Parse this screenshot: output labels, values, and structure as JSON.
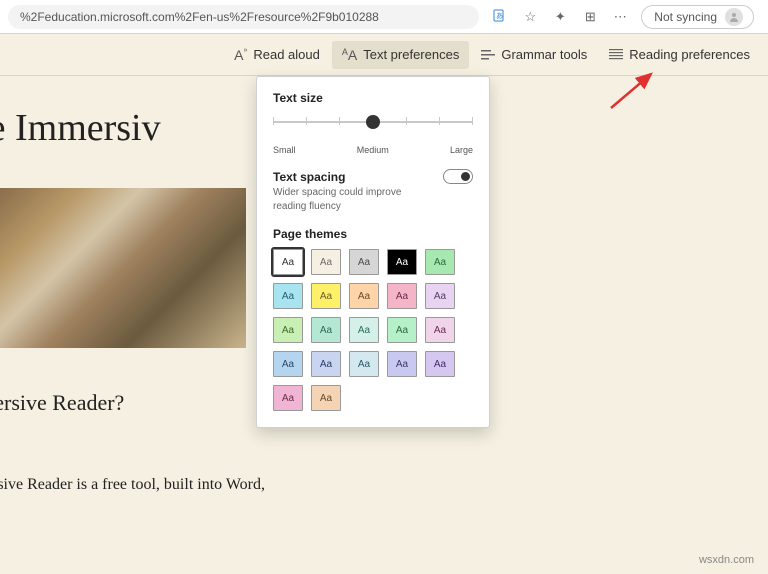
{
  "address_bar": {
    "url": "%2Feducation.microsoft.com%2Fen-us%2Fresource%2F9b010288",
    "sync_label": "Not syncing"
  },
  "toolbar": {
    "read_aloud": "Read aloud",
    "text_preferences": "Text preferences",
    "grammar_tools": "Grammar tools",
    "reading_preferences": "Reading preferences"
  },
  "page": {
    "heading1": "ut the Immersiv",
    "heading2": "mmersive Reader?",
    "body1": "mmersive Reader is a free tool, built into Word,"
  },
  "popover": {
    "text_size_label": "Text size",
    "slider": {
      "min_label": "Small",
      "mid_label": "Medium",
      "max_label": "Large"
    },
    "text_spacing_label": "Text spacing",
    "text_spacing_hint": "Wider spacing could improve reading fluency",
    "page_themes_label": "Page themes",
    "swatch_text": "Aa",
    "themes": [
      {
        "bg": "#ffffff",
        "fg": "#333333",
        "selected": true
      },
      {
        "bg": "#f5f0e1",
        "fg": "#6b6b6b"
      },
      {
        "bg": "#d6d6d6",
        "fg": "#4a4a4a"
      },
      {
        "bg": "#000000",
        "fg": "#ffffff"
      },
      {
        "bg": "#a7e8b0",
        "fg": "#2a6b36"
      },
      {
        "bg": "#a8e4f0",
        "fg": "#2a5c6b"
      },
      {
        "bg": "#fff06a",
        "fg": "#6b5a2a"
      },
      {
        "bg": "#ffd4a8",
        "fg": "#6b4a2a"
      },
      {
        "bg": "#f5b5c8",
        "fg": "#6b2a4a"
      },
      {
        "bg": "#e8d4f0",
        "fg": "#5a3a6b"
      },
      {
        "bg": "#c8f0b5",
        "fg": "#3a6b2a"
      },
      {
        "bg": "#b5e8d4",
        "fg": "#2a6b5a"
      },
      {
        "bg": "#d4f0e8",
        "fg": "#2a6b5a"
      },
      {
        "bg": "#b5f0c8",
        "fg": "#2a6b3a"
      },
      {
        "bg": "#f0d4e8",
        "fg": "#6b2a5a"
      },
      {
        "bg": "#b5d4f0",
        "fg": "#2a4a6b"
      },
      {
        "bg": "#c8d4f0",
        "fg": "#2a3a6b"
      },
      {
        "bg": "#d4e8f0",
        "fg": "#2a5a6b"
      },
      {
        "bg": "#c8c8f0",
        "fg": "#3a3a6b"
      },
      {
        "bg": "#d4c8f0",
        "fg": "#4a2a6b"
      },
      {
        "bg": "#f0b5d4",
        "fg": "#6b2a4a"
      },
      {
        "bg": "#f5d4b5",
        "fg": "#6b4a2a"
      }
    ]
  },
  "watermark": "wsxdn.com"
}
